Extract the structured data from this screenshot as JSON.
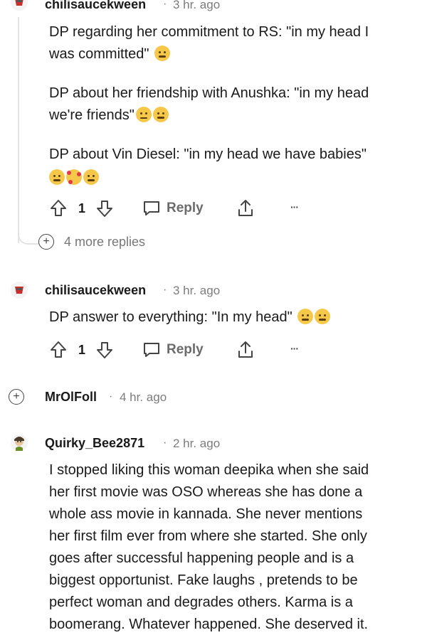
{
  "comment1": {
    "username": "chilisaucekween",
    "separator": "·",
    "time": "3 hr. ago",
    "line1": "DP regarding her commitment to RS: \"in my head I",
    "line2": "was committed\"",
    "line3": "DP about her friendship with Anushka: \"in my head",
    "line4": "we're friends\"",
    "line5": "DP about Vin Diesel: \"in my head we have babies\"",
    "vote_count": "1",
    "reply_label": "Reply",
    "more_label": "···",
    "more_replies": "4 more replies"
  },
  "comment2": {
    "username": "chilisaucekween",
    "separator": "·",
    "time": "3 hr. ago",
    "body": "DP answer to everything: \"In my head\"",
    "vote_count": "1",
    "reply_label": "Reply",
    "more_label": "···"
  },
  "comment3": {
    "username": "MrOlFoll",
    "separator": "·",
    "time": "4 hr. ago"
  },
  "comment4": {
    "username": "Quirky_Bee2871",
    "separator": "·",
    "time": "2 hr. ago",
    "lines": [
      "I stopped liking this woman deepika when she said",
      "her first movie was OSO whereas she has done a",
      "whole ass movie in kannada. She never mentions",
      "her first film ever from where she started. She only",
      "goes after successful happening people and is a",
      "biggest opportunist. Fake laughs , pretends to be",
      "perfect woman and degrades others. Karma is a",
      "boomerang. Whatever happened. She deserved it."
    ]
  },
  "icons": {
    "upvote": "upvote-icon",
    "downvote": "downvote-icon",
    "reply": "chat-bubble-icon",
    "share": "share-icon",
    "expand": "plus-icon"
  }
}
